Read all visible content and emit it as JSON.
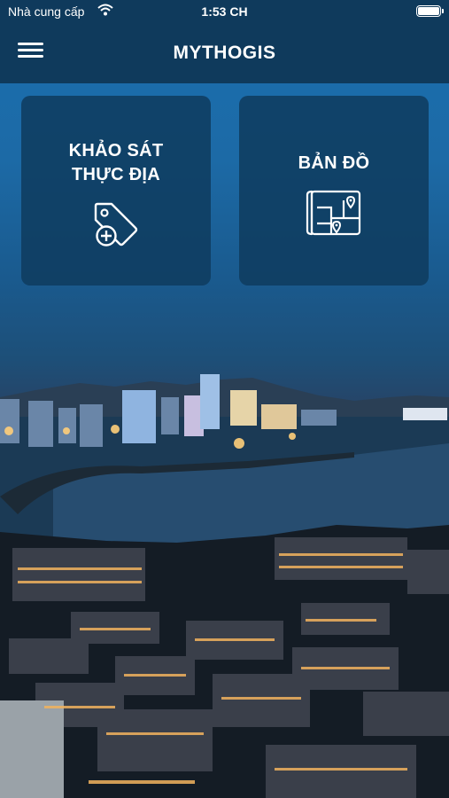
{
  "status_bar": {
    "carrier": "Nhà cung cấp",
    "time": "1:53 CH"
  },
  "header": {
    "title": "MYTHOGIS",
    "menu_icon": "hamburger-menu-icon"
  },
  "tiles": [
    {
      "title_line1": "KHẢO SÁT",
      "title_line2": "THỰC ĐỊA",
      "icon": "tag-add-icon"
    },
    {
      "title": "BẢN ĐỒ",
      "icon": "map-pin-icon"
    }
  ],
  "colors": {
    "header_bg": "#0f3a5c",
    "tile_bg": "#0f3c60",
    "text": "#ffffff"
  }
}
